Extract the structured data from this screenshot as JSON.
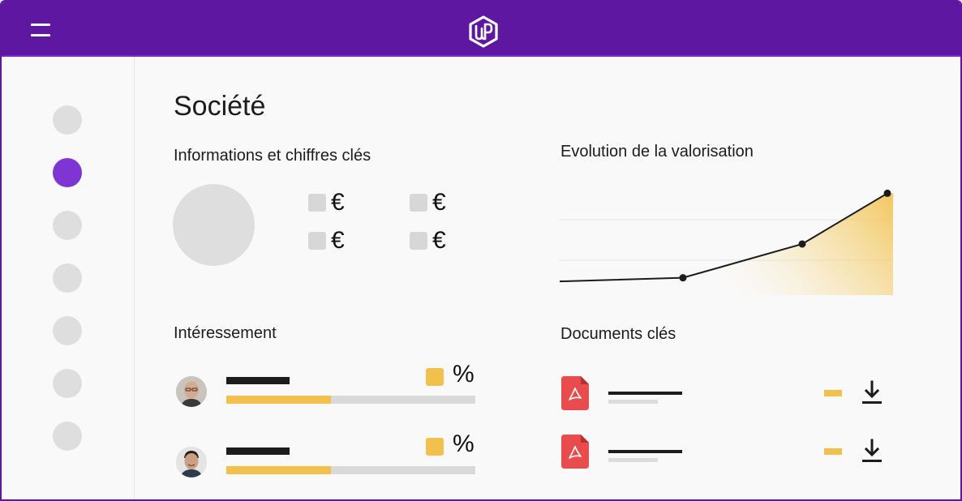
{
  "header": {
    "menu_icon": "hamburger-menu-icon",
    "logo_icon": "wp-hexagon-logo-icon",
    "brand_color": "#5e17a0"
  },
  "sidebar": {
    "items": [
      {
        "active": false
      },
      {
        "active": true
      },
      {
        "active": false
      },
      {
        "active": false
      },
      {
        "active": false
      },
      {
        "active": false
      },
      {
        "active": false
      }
    ],
    "active_color": "#7f35d4"
  },
  "page": {
    "title": "Société"
  },
  "info": {
    "title": "Informations et chiffres clés",
    "kpis": [
      "€",
      "€",
      "€",
      "€"
    ]
  },
  "valuation": {
    "title": "Evolution de la valorisation"
  },
  "chart_data": {
    "type": "line",
    "title": "Evolution de la valorisation",
    "series": [
      {
        "values": [
          1,
          1.3,
          4.1,
          8.3
        ]
      }
    ],
    "grid": true,
    "point_markers": [
      false,
      true,
      true,
      true
    ]
  },
  "interessement": {
    "title": "Intéressement",
    "rows": [
      {
        "percent_symbol": "%",
        "progress": 0.42,
        "avatar": "man-bald-glasses-avatar"
      },
      {
        "percent_symbol": "%",
        "progress": 0.42,
        "avatar": "man-smiling-avatar"
      }
    ],
    "accent_color": "#f2c14d"
  },
  "documents": {
    "title": "Documents clés",
    "items": [
      {
        "file_icon": "pdf-file-icon",
        "action_icon": "download-icon"
      },
      {
        "file_icon": "pdf-file-icon",
        "action_icon": "download-icon"
      }
    ],
    "pdf_color": "#e84c4c"
  }
}
